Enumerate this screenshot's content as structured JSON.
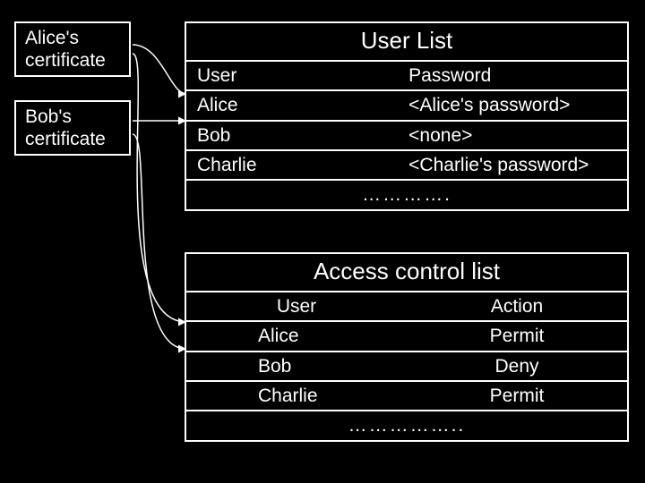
{
  "certificates": {
    "alice": "Alice's certificate",
    "bob": "Bob's certificate"
  },
  "user_list": {
    "title": "User List",
    "headers": {
      "user": "User",
      "password": "Password"
    },
    "rows": [
      {
        "user": "Alice",
        "password": "<Alice's password>"
      },
      {
        "user": "Bob",
        "password": "<none>"
      },
      {
        "user": "Charlie",
        "password": "<Charlie's password>"
      }
    ],
    "ellipsis": "…………."
  },
  "acl": {
    "title": "Access control list",
    "headers": {
      "user": "User",
      "action": "Action"
    },
    "rows": [
      {
        "user": "Alice",
        "action": "Permit"
      },
      {
        "user": "Bob",
        "action": "Deny"
      },
      {
        "user": "Charlie",
        "action": "Permit"
      }
    ],
    "ellipsis": "…………….."
  }
}
